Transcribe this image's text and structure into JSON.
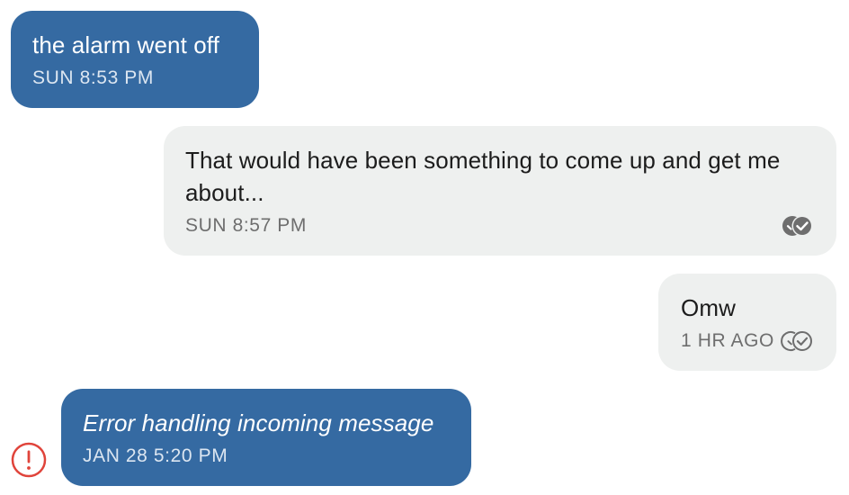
{
  "messages": [
    {
      "direction": "incoming",
      "text": "the alarm went off",
      "timestamp": "SUN 8:53 PM"
    },
    {
      "direction": "outgoing",
      "text": "That would have been something to come up and get me about...",
      "timestamp": "SUN 8:57 PM",
      "receipt_icon": "double-check-filled-icon"
    },
    {
      "direction": "outgoing",
      "text": "Omw",
      "timestamp": "1 HR AGO",
      "receipt_icon": "double-check-outline-icon"
    },
    {
      "direction": "incoming",
      "text": "Error handling incoming message",
      "timestamp": "JAN 28 5:20 PM",
      "status_icon": "error-alert-icon"
    }
  ],
  "colors": {
    "incoming_bubble": "#356aa2",
    "outgoing_bubble": "#eef0ef",
    "error": "#e0443b",
    "receipt": "#6e6e6e"
  }
}
